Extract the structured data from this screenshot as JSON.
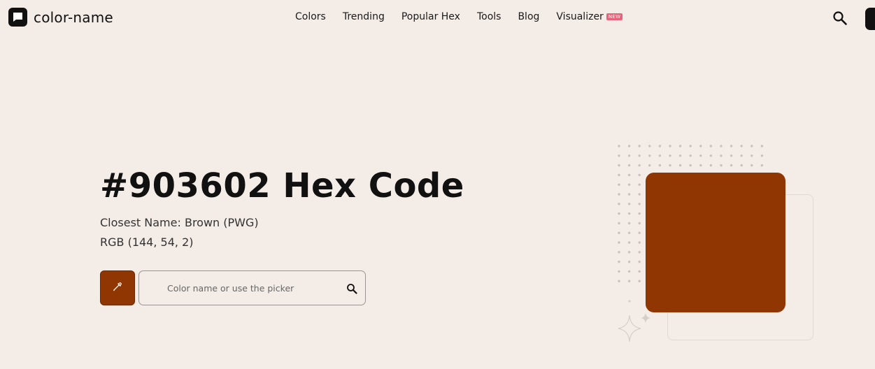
{
  "brand": {
    "name": "color-name",
    "icon": "chat-bubble-icon"
  },
  "nav": {
    "items": [
      {
        "label": "Colors"
      },
      {
        "label": "Trending"
      },
      {
        "label": "Popular Hex"
      },
      {
        "label": "Tools"
      },
      {
        "label": "Blog"
      },
      {
        "label": "Visualizer",
        "badge": "NEW"
      }
    ]
  },
  "header": {
    "search_icon": "search-icon"
  },
  "hero": {
    "title": "#903602 Hex Code",
    "closest_name": "Closest Name: Brown (PWG)",
    "rgb": "RGB (144, 54, 2)",
    "picker_icon": "eyedropper-icon",
    "search_placeholder": "Color name or use the picker"
  },
  "colors": {
    "swatch": "#903602",
    "background": "#f4ece7",
    "badge": "#e8637a"
  }
}
